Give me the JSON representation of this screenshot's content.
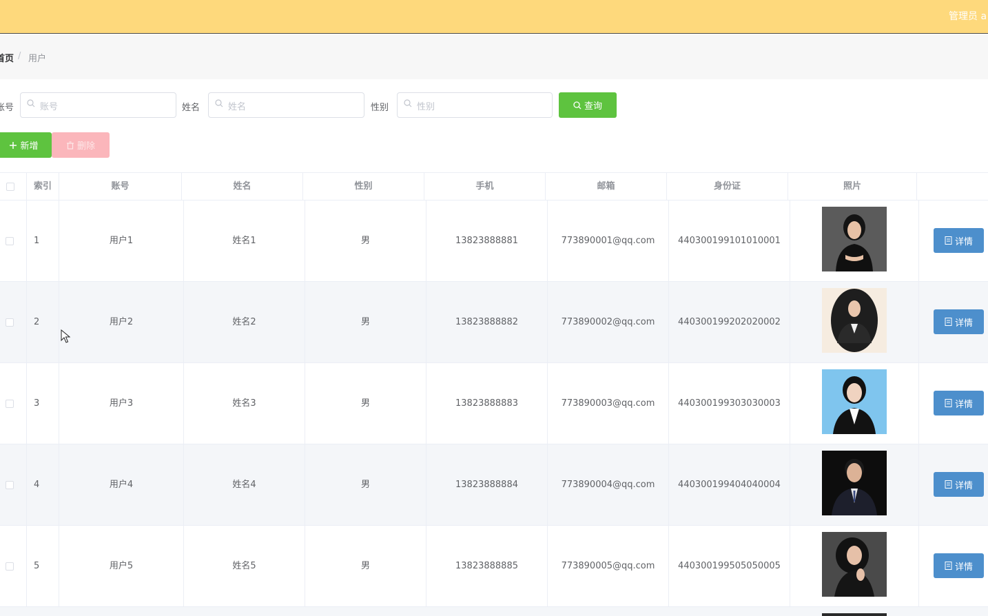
{
  "header": {
    "user_label": "管理员 a"
  },
  "breadcrumb": {
    "home": "首页",
    "separator": "/",
    "current": "用户"
  },
  "filters": {
    "account_label": "账号",
    "account_placeholder": "账号",
    "name_label": "姓名",
    "name_placeholder": "姓名",
    "gender_label": "性别",
    "gender_placeholder": "性别",
    "query_button": "查询"
  },
  "actions": {
    "add_button": "新增",
    "delete_button": "删除"
  },
  "table": {
    "columns": [
      "索引",
      "账号",
      "姓名",
      "性别",
      "手机",
      "邮箱",
      "身份证",
      "照片",
      ""
    ],
    "rows": [
      {
        "index": "1",
        "account": "用户1",
        "name": "姓名1",
        "gender": "男",
        "phone": "13823888881",
        "email": "773890001@qq.com",
        "id_card": "440300199101010001",
        "detail": "详情"
      },
      {
        "index": "2",
        "account": "用户2",
        "name": "姓名2",
        "gender": "男",
        "phone": "13823888882",
        "email": "773890002@qq.com",
        "id_card": "440300199202020002",
        "detail": "详情"
      },
      {
        "index": "3",
        "account": "用户3",
        "name": "姓名3",
        "gender": "男",
        "phone": "13823888883",
        "email": "773890003@qq.com",
        "id_card": "440300199303030003",
        "detail": "详情"
      },
      {
        "index": "4",
        "account": "用户4",
        "name": "姓名4",
        "gender": "男",
        "phone": "13823888884",
        "email": "773890004@qq.com",
        "id_card": "440300199404040004",
        "detail": "详情"
      },
      {
        "index": "5",
        "account": "用户5",
        "name": "姓名5",
        "gender": "男",
        "phone": "13823888885",
        "email": "773890005@qq.com",
        "id_card": "440300199505050005",
        "detail": "详情"
      }
    ]
  },
  "colors": {
    "topbar": "#fed97c",
    "success": "#5ec33f",
    "danger_light": "#fbb6bb",
    "primary": "#4d8fcc",
    "stripe": "#f4f6f9"
  },
  "icons": {
    "search": "search-icon",
    "add": "plus-icon",
    "delete": "trash-icon",
    "detail": "document-icon",
    "cursor": "mouse-pointer-icon"
  }
}
